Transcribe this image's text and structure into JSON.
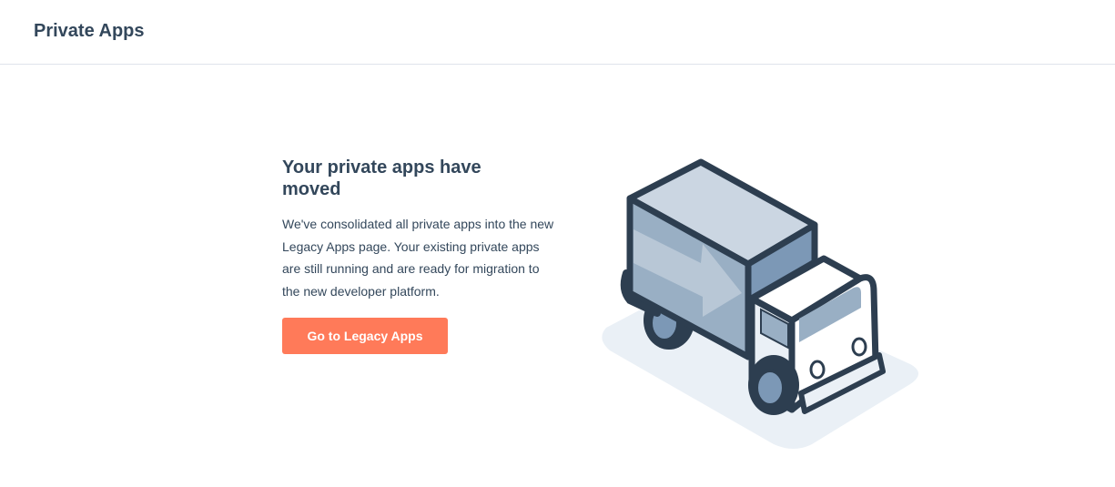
{
  "header": {
    "title": "Private Apps"
  },
  "main": {
    "heading": "Your private apps have moved",
    "body": "We've consolidated all private apps into the new Legacy Apps page. Your existing private apps are still running and are ready for migration to the new developer platform.",
    "cta_label": "Go to Legacy Apps"
  },
  "illustration": {
    "icon": "moving-truck-illustration"
  },
  "colors": {
    "accent": "#ff7a59",
    "text": "#33475b",
    "divider": "#dfe3eb",
    "truck_outline": "#2d3e50",
    "truck_cargo_top": "#cbd6e2",
    "truck_cargo_side": "#99afc4",
    "truck_cargo_front": "#7c98b6",
    "shadow": "#eaf0f6"
  }
}
